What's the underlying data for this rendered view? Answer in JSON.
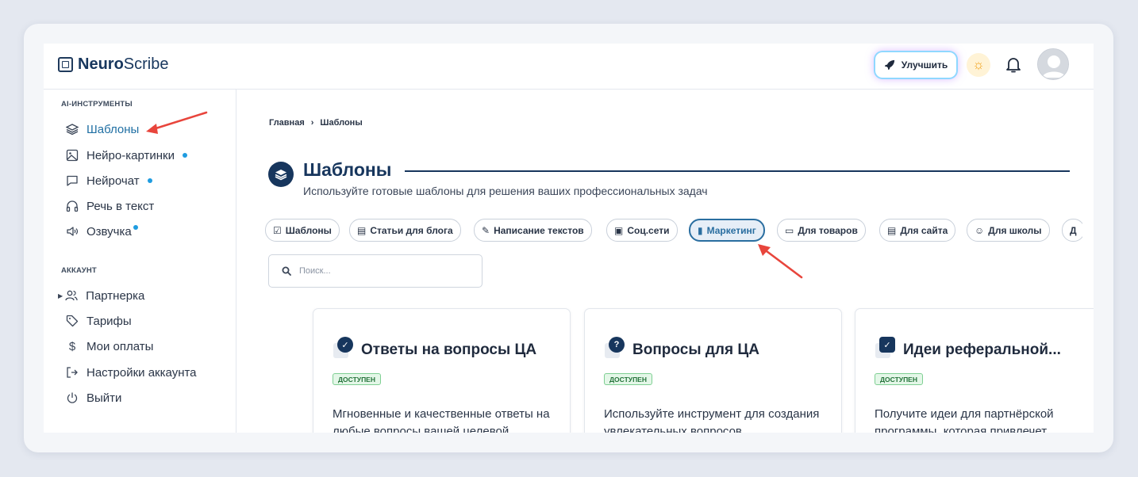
{
  "header": {
    "logo_bold": "Neuro",
    "logo_light": "Scribe",
    "upgrade_label": "Улучшить"
  },
  "sidebar": {
    "section_tools": "AI-ИНСТРУМЕНТЫ",
    "tools": [
      {
        "label": "Шаблоны",
        "icon": "layers-icon",
        "dot": false,
        "active": true
      },
      {
        "label": "Нейро-картинки",
        "icon": "image-icon",
        "dot": true
      },
      {
        "label": "Нейрочат",
        "icon": "chat-icon",
        "dot": true
      },
      {
        "label": "Речь в текст",
        "icon": "headphones-icon",
        "dot": false
      },
      {
        "label": "Озвучка",
        "icon": "speaker-icon",
        "dot": true
      }
    ],
    "section_account": "АККАУНТ",
    "account": [
      {
        "label": "Партнерка",
        "icon": "users-icon"
      },
      {
        "label": "Тарифы",
        "icon": "tag-icon"
      },
      {
        "label": "Мои оплаты",
        "icon": "dollar-icon"
      },
      {
        "label": "Настройки аккаунта",
        "icon": "login-icon"
      },
      {
        "label": "Выйти",
        "icon": "power-icon"
      }
    ]
  },
  "main": {
    "breadcrumb": {
      "home": "Главная",
      "separator": "›",
      "current": "Шаблоны"
    },
    "title": "Шаблоны",
    "subtitle": "Используйте готовые шаблоны для решения ваших профессиональных задач",
    "chips": [
      {
        "label": "Шаблоны",
        "icon": "☑"
      },
      {
        "label": "Статьи для блога",
        "icon": "▤"
      },
      {
        "label": "Написание текстов",
        "icon": "✎"
      },
      {
        "label": "Соц.сети",
        "icon": "▣"
      },
      {
        "label": "Маркетинг",
        "icon": "▮",
        "active": true
      },
      {
        "label": "Для товаров",
        "icon": "▭"
      },
      {
        "label": "Для сайта",
        "icon": "▤"
      },
      {
        "label": "Для школы",
        "icon": "☺"
      },
      {
        "label": "Д",
        "icon": ""
      }
    ],
    "search_placeholder": "Поиск...",
    "cards": [
      {
        "title": "Ответы на вопросы ЦА",
        "badge": "ДОСТУПЕН",
        "desc": "Мгновенные и качественные ответы на любые вопросы вашей целевой",
        "icon": "check-icon",
        "glyph": "✓"
      },
      {
        "title": "Вопросы для ЦА",
        "badge": "ДОСТУПЕН",
        "desc": "Используйте инструмент для создания увлекательных вопросов",
        "icon": "question-icon",
        "glyph": "?"
      },
      {
        "title": "Идеи реферальной...",
        "badge": "ДОСТУПЕН",
        "desc": "Получите идеи для партнёрской программы, которая привлечет",
        "icon": "checkbox-icon",
        "glyph": "✓"
      }
    ]
  },
  "colors": {
    "brand": "#17365d",
    "accent": "#1f6fa3",
    "dot": "#1f9ce0",
    "arrow": "#e8453c"
  }
}
